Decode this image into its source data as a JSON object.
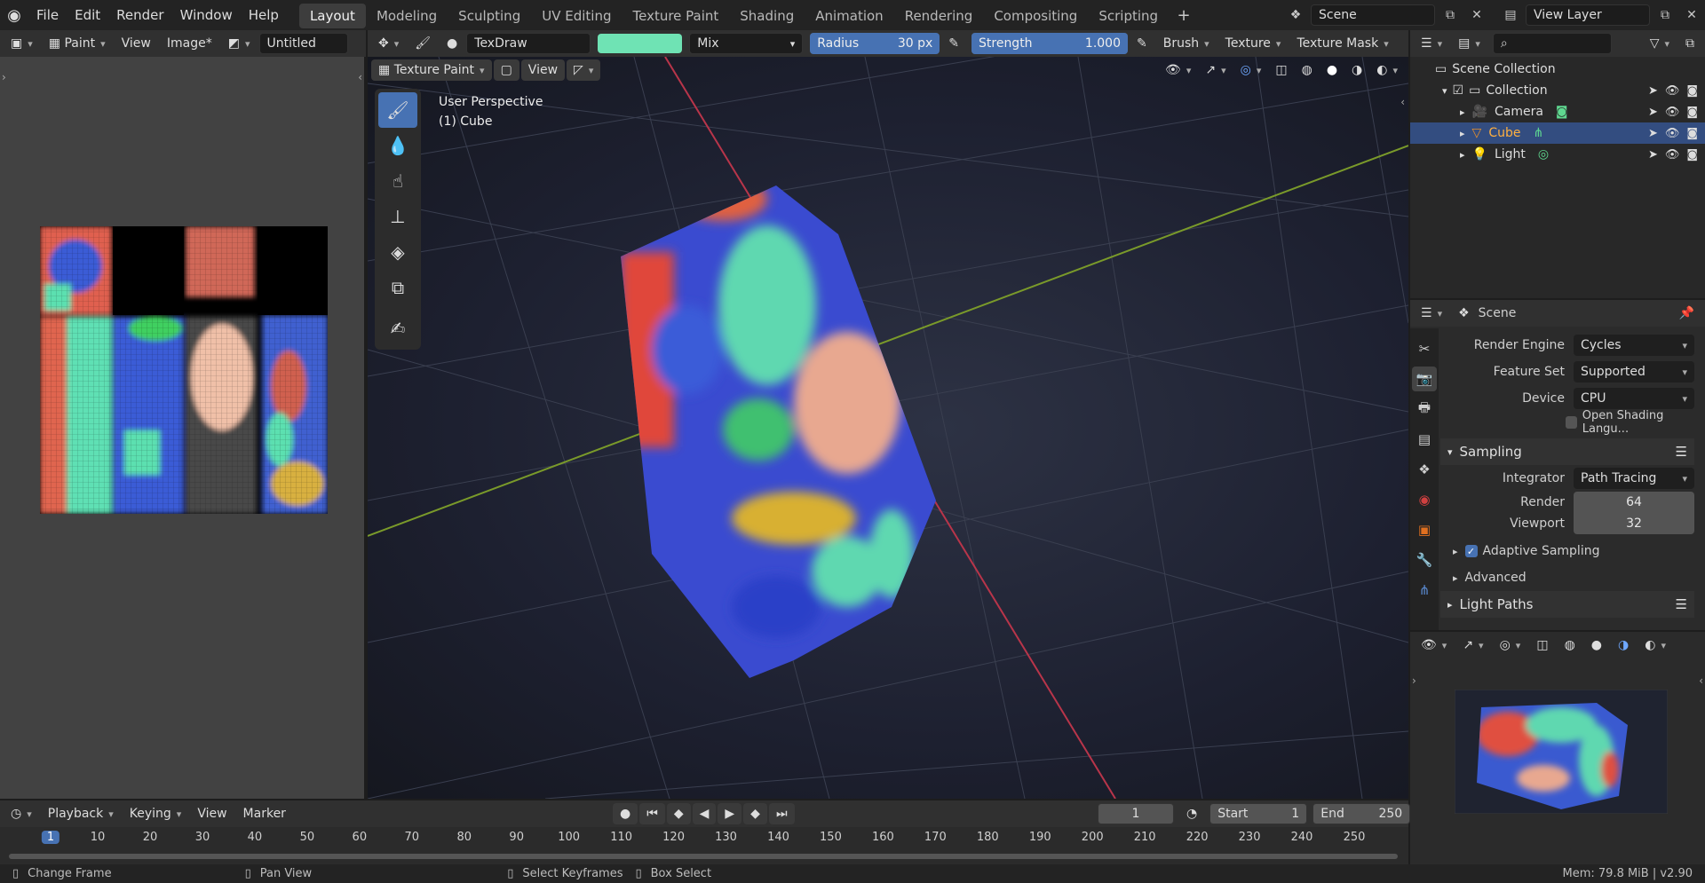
{
  "menus": [
    "File",
    "Edit",
    "Render",
    "Window",
    "Help"
  ],
  "workspaces": [
    "Layout",
    "Modeling",
    "Sculpting",
    "UV Editing",
    "Texture Paint",
    "Shading",
    "Animation",
    "Rendering",
    "Compositing",
    "Scripting"
  ],
  "active_workspace": "Layout",
  "scene_name": "Scene",
  "view_layer": "View Layer",
  "image_editor": {
    "mode": "Paint",
    "view": "View",
    "image_menu": "Image*",
    "image_name": "Untitled"
  },
  "tool_header": {
    "brush_name": "TexDraw",
    "brush_color": "#6fe3b4",
    "blend": "Mix",
    "radius_label": "Radius",
    "radius_value": "30 px",
    "strength_label": "Strength",
    "strength_value": "1.000",
    "strength_fraction": 1.0,
    "brush_menu": "Brush",
    "texture_menu": "Texture",
    "texture_mask_menu": "Texture Mask"
  },
  "viewport": {
    "mode": "Texture Paint",
    "view": "View",
    "perspective": "User Perspective",
    "object": "(1) Cube"
  },
  "outliner": {
    "root": "Scene Collection",
    "collection": "Collection",
    "items": [
      {
        "name": "Camera",
        "selected": false
      },
      {
        "name": "Cube",
        "selected": true
      },
      {
        "name": "Light",
        "selected": false
      }
    ]
  },
  "properties": {
    "context": "Scene",
    "render_engine_label": "Render Engine",
    "render_engine": "Cycles",
    "feature_set_label": "Feature Set",
    "feature_set": "Supported",
    "device_label": "Device",
    "device": "CPU",
    "osl_label": "Open Shading Langu...",
    "sampling": "Sampling",
    "integrator_label": "Integrator",
    "integrator": "Path Tracing",
    "render_label": "Render",
    "render_samples": "64",
    "viewport_label": "Viewport",
    "viewport_samples": "32",
    "adaptive": "Adaptive Sampling",
    "advanced": "Advanced",
    "light_paths": "Light Paths"
  },
  "timeline": {
    "playback": "Playback",
    "keying": "Keying",
    "view": "View",
    "marker": "Marker",
    "current_frame": "1",
    "start_label": "Start",
    "start": "1",
    "end_label": "End",
    "end": "250",
    "ticks": [
      "1",
      "10",
      "20",
      "30",
      "40",
      "50",
      "60",
      "70",
      "80",
      "90",
      "100",
      "110",
      "120",
      "130",
      "140",
      "150",
      "160",
      "170",
      "180",
      "190",
      "200",
      "210",
      "220",
      "230",
      "240",
      "250"
    ]
  },
  "status": {
    "change_frame": "Change Frame",
    "pan_view": "Pan View",
    "select_keyframes": "Select Keyframes",
    "box_select": "Box Select",
    "memory": "Mem: 79.8 MiB | v2.90"
  }
}
